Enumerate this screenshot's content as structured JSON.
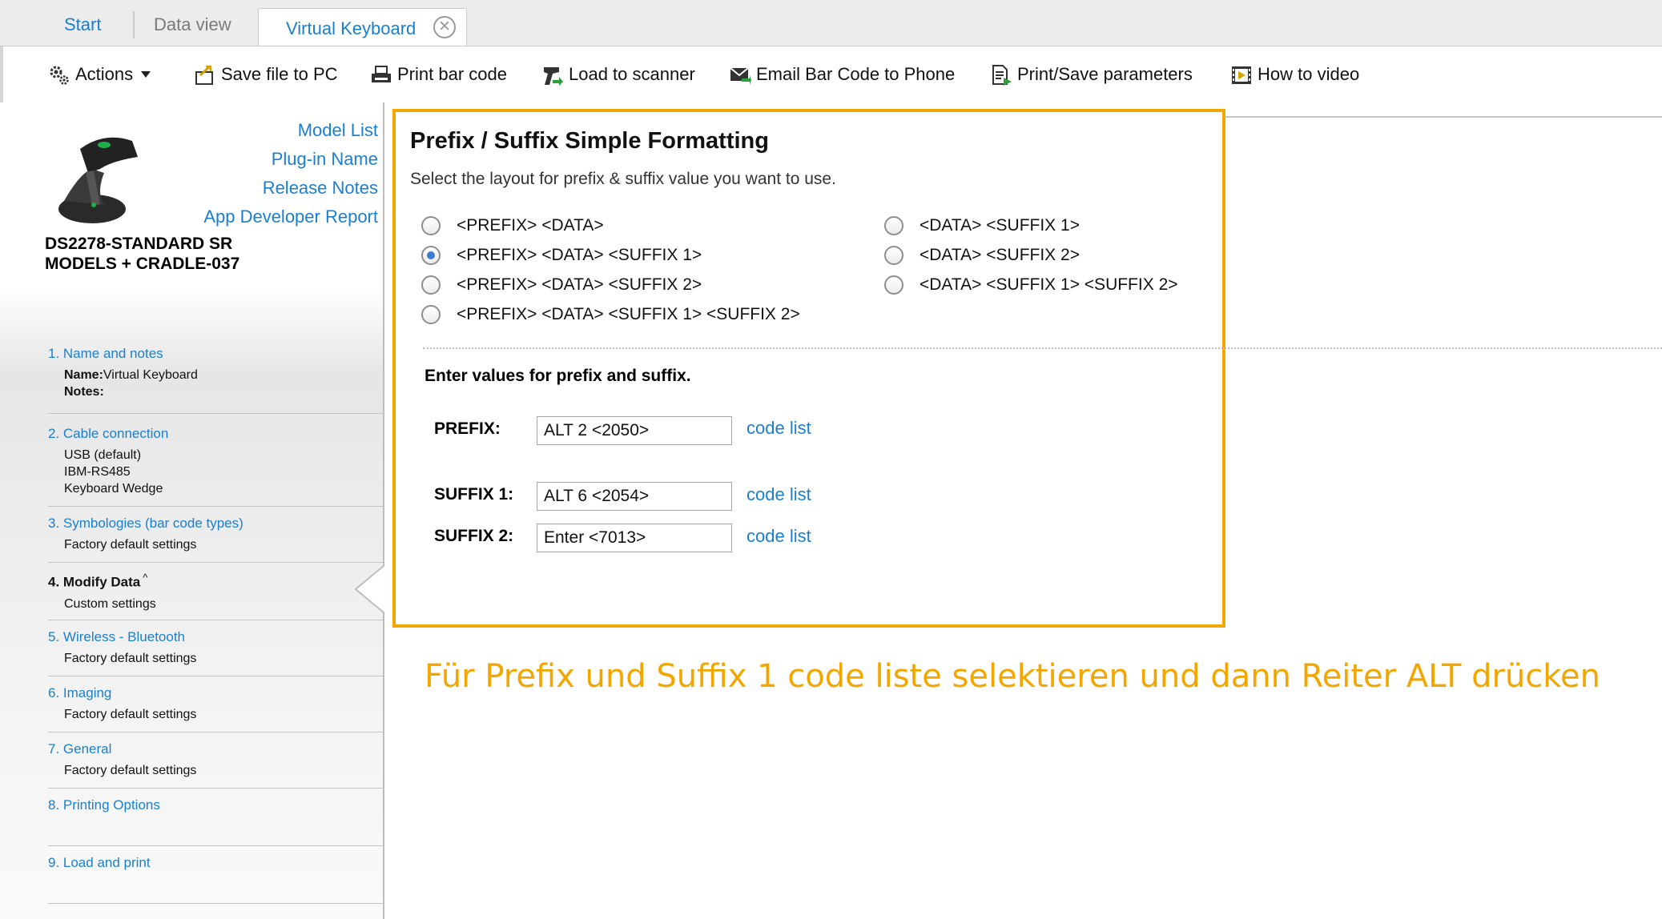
{
  "tabs": {
    "start": "Start",
    "data_view": "Data view",
    "active": "Virtual Keyboard",
    "close_symbol": "✕"
  },
  "toolbar": {
    "actions": "Actions",
    "save": "Save file to PC",
    "print": "Print bar code",
    "load": "Load to scanner",
    "email": "Email Bar Code to Phone",
    "params": "Print/Save parameters",
    "video": "How to video"
  },
  "sidebar": {
    "links": [
      "Model List",
      "Plug-in Name",
      "Release Notes",
      "App Developer Report"
    ],
    "model_name_line1": "DS2278-STANDARD SR",
    "model_name_line2": "MODELS + CRADLE-037",
    "steps": [
      {
        "title": "1.  Name and notes",
        "name_label": "Name:",
        "name_value": "Virtual Keyboard",
        "notes_label": "Notes:"
      },
      {
        "title": "2.  Cable connection",
        "lines": [
          "USB (default)",
          "IBM-RS485",
          "Keyboard Wedge"
        ]
      },
      {
        "title": "3.  Symbologies (bar code types)",
        "lines": [
          "Factory default settings"
        ]
      },
      {
        "title": "4.  Modify Data",
        "marker": "^",
        "lines": [
          "Custom settings"
        ]
      },
      {
        "title": "5.  Wireless - Bluetooth",
        "lines": [
          "Factory default settings"
        ]
      },
      {
        "title": "6.  Imaging",
        "lines": [
          "Factory default settings"
        ]
      },
      {
        "title": "7.  General",
        "lines": [
          "Factory default settings"
        ]
      },
      {
        "title": "8.  Printing Options"
      },
      {
        "title": "9.  Load and print"
      }
    ]
  },
  "panel": {
    "title": "Prefix / Suffix Simple Formatting",
    "subtitle": "Select the layout for prefix & suffix value you want to use.",
    "options": [
      {
        "label": "<PREFIX> <DATA>",
        "checked": false
      },
      {
        "label": "<PREFIX> <DATA> <SUFFIX 1>",
        "checked": true
      },
      {
        "label": "<PREFIX> <DATA> <SUFFIX 2>",
        "checked": false
      },
      {
        "label": "<PREFIX> <DATA> <SUFFIX 1> <SUFFIX 2>",
        "checked": false
      },
      {
        "label": "<DATA> <SUFFIX 1>",
        "checked": false
      },
      {
        "label": "<DATA> <SUFFIX 2>",
        "checked": false
      },
      {
        "label": "<DATA> <SUFFIX 1> <SUFFIX 2>",
        "checked": false
      }
    ],
    "enter_values": "Enter values for prefix and suffix.",
    "prefix_label": "PREFIX:",
    "prefix_value": "ALT 2 <2050>",
    "suffix1_label": "SUFFIX 1:",
    "suffix1_value": "ALT 6 <2054>",
    "suffix2_label": "SUFFIX 2:",
    "suffix2_value": "Enter <7013>",
    "code_list": "code list"
  },
  "annotation": "Für Prefix und Suffix 1 code liste selektieren und dann Reiter ALT drücken",
  "colors": {
    "accent": "#1a7fd1",
    "highlight": "#f2a600"
  }
}
